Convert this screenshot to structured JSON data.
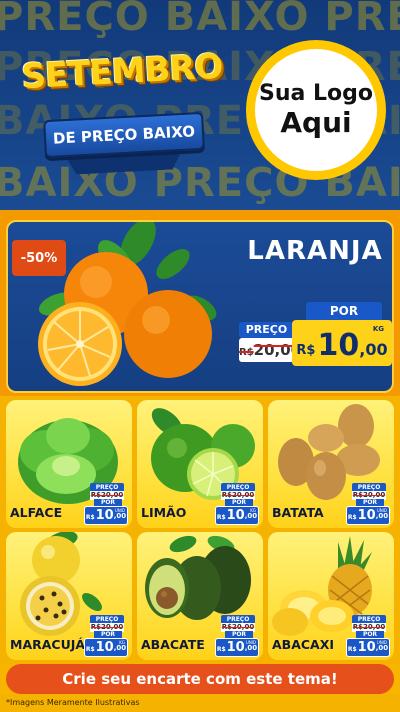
{
  "header": {
    "background_words": [
      "PREÇO BAIXO PREÇO",
      "PREÇO BAIXO PREÇO",
      "BAIXO PREÇO BAIXO",
      "BAIXO PREÇO BAIXO"
    ],
    "title": "SETEMBRO",
    "subtitle": "DE PREÇO BAIXO",
    "logo_line1": "Sua Logo",
    "logo_line2": "Aqui"
  },
  "featured": {
    "discount": "-50%",
    "name": "LARANJA",
    "old_label": "PREÇO",
    "old_currency": "R$",
    "old_value": "20,00",
    "por_label": "POR",
    "currency": "R$",
    "price_int": "10",
    "price_dec": ",00",
    "unit": "KG"
  },
  "products": [
    {
      "name": "ALFACE",
      "old_label": "PREÇO",
      "old": "R$20,00",
      "por": "POR",
      "cur": "R$",
      "int": "10",
      "dec": ",00",
      "unit": "UNID"
    },
    {
      "name": "LIMÃO",
      "old_label": "PREÇO",
      "old": "R$20,00",
      "por": "POR",
      "cur": "R$",
      "int": "10",
      "dec": ",00",
      "unit": "KG"
    },
    {
      "name": "BATATA",
      "old_label": "PREÇO",
      "old": "R$20,00",
      "por": "POR",
      "cur": "R$",
      "int": "10",
      "dec": ",00",
      "unit": "UNID"
    },
    {
      "name": "MARACUJÁ",
      "old_label": "PREÇO",
      "old": "R$20,00",
      "por": "POR",
      "cur": "R$",
      "int": "10",
      "dec": ",00",
      "unit": "KG"
    },
    {
      "name": "ABACATE",
      "old_label": "PREÇO",
      "old": "R$20,00",
      "por": "POR",
      "cur": "R$",
      "int": "10",
      "dec": ",00",
      "unit": "UNID"
    },
    {
      "name": "ABACAXI",
      "old_label": "PREÇO",
      "old": "R$20,00",
      "por": "POR",
      "cur": "R$",
      "int": "10",
      "dec": ",00",
      "unit": "UNID"
    }
  ],
  "footer": {
    "cta": "Crie seu encarte com este tema!",
    "disclaimer": "*Imagens Meramente Ilustrativas"
  },
  "colors": {
    "navy": "#163f82",
    "yellow": "#ffd21a",
    "orange": "#f39a00",
    "cta_orange": "#e6501a",
    "price_blue": "#1a58c8"
  }
}
